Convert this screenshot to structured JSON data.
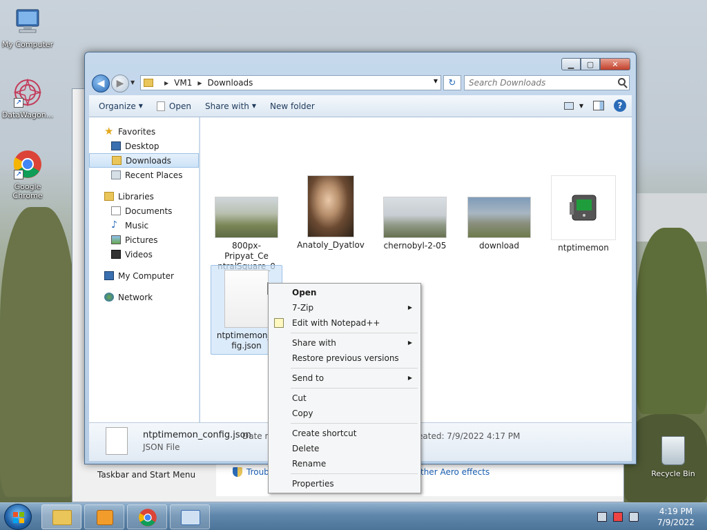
{
  "desktop": {
    "icons": [
      {
        "label": "My Computer"
      },
      {
        "label": "DataWagon..."
      },
      {
        "label": "Google Chrome"
      }
    ],
    "recycle_bin": "Recycle Bin"
  },
  "background_window": {
    "footer_left": "Taskbar and Start Menu",
    "link_trouble": "Troub",
    "link_aero": "ther Aero effects"
  },
  "explorer": {
    "breadcrumb": [
      "VM1",
      "Downloads"
    ],
    "search_placeholder": "Search Downloads",
    "toolbar": {
      "organize": "Organize",
      "open": "Open",
      "share_with": "Share with",
      "new_folder": "New folder"
    },
    "nav": {
      "favorites": "Favorites",
      "favorites_items": [
        "Desktop",
        "Downloads",
        "Recent Places"
      ],
      "libraries": "Libraries",
      "libraries_items": [
        "Documents",
        "Music",
        "Pictures",
        "Videos"
      ],
      "my_computer": "My Computer",
      "network": "Network"
    },
    "files": [
      {
        "name": "800px-Pripyat_CentralSquare_0",
        "line1": "800px-Pripyat_Ce",
        "line2": "ntralSquare_0"
      },
      {
        "name": "Anatoly_Dyatlov",
        "line1": "Anatoly_Dyatlov",
        "line2": ""
      },
      {
        "name": "chernobyl-2-05",
        "line1": "chernobyl-2-05",
        "line2": ""
      },
      {
        "name": "download",
        "line1": "download",
        "line2": ""
      },
      {
        "name": "ntptimemon",
        "line1": "ntptimemon",
        "line2": ""
      },
      {
        "name": "ntptimemon_config.json",
        "line1": "ntptimemon_c",
        "line2": "fig.json"
      }
    ],
    "details": {
      "name": "ntptimemon_config.json",
      "type": "JSON File",
      "modified_label": "Date m",
      "created": "eated:  7/9/2022 4:17 PM"
    }
  },
  "context_menu": {
    "open": "Open",
    "seven_zip": "7-Zip",
    "edit_notepad": "Edit with Notepad++",
    "share_with": "Share with",
    "restore": "Restore previous versions",
    "send_to": "Send to",
    "cut": "Cut",
    "copy": "Copy",
    "create_shortcut": "Create shortcut",
    "delete": "Delete",
    "rename": "Rename",
    "properties": "Properties"
  },
  "taskbar": {
    "time": "4:19 PM",
    "date": "7/9/2022"
  },
  "colors": {
    "accent": "#2b6cb8",
    "selection": "#cde3f8",
    "taskbar": "#5f86ab"
  }
}
